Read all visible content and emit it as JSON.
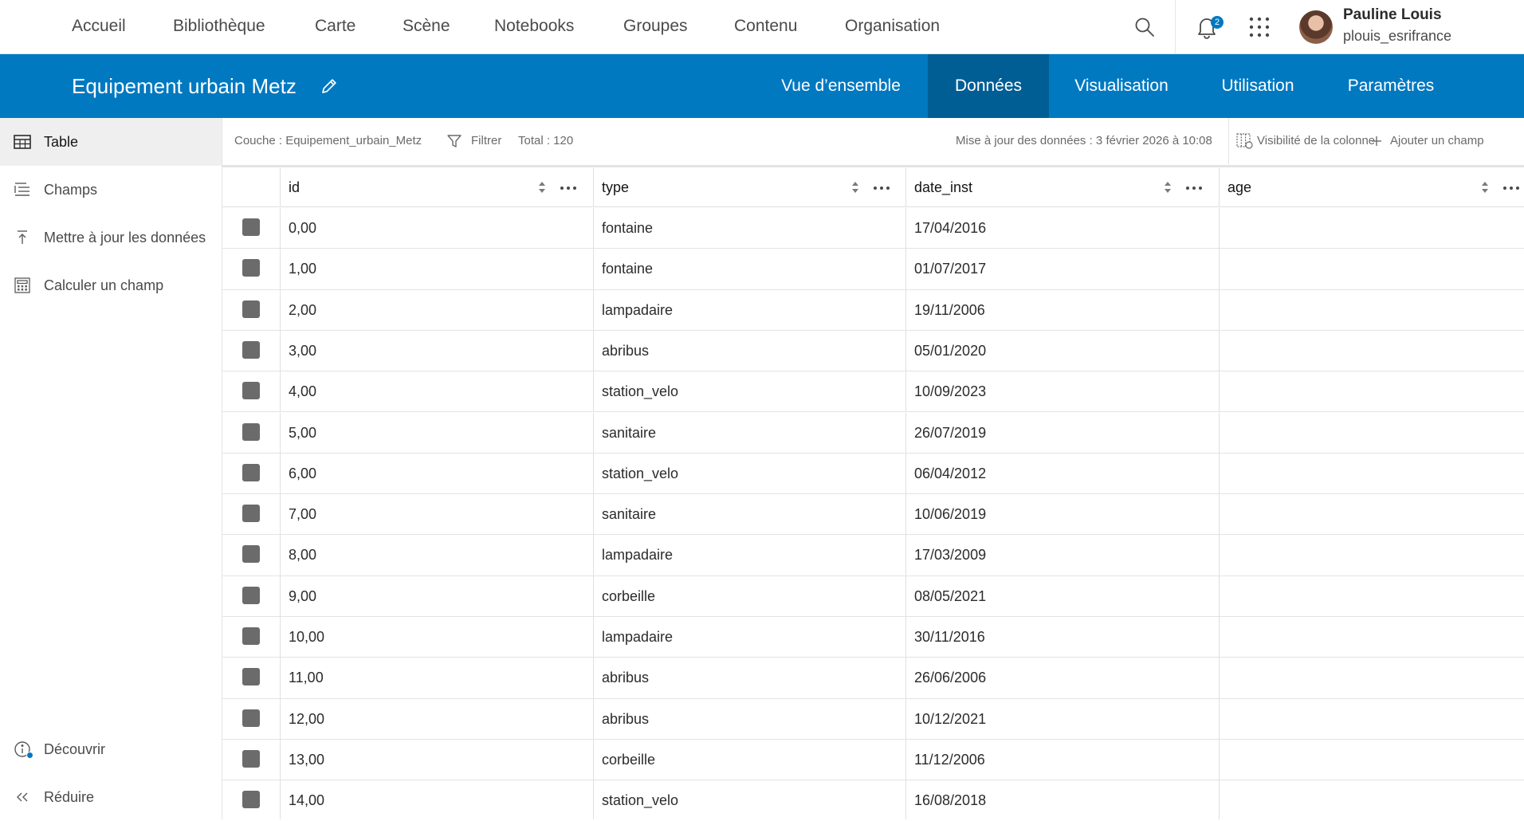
{
  "topnav": {
    "links": [
      "Accueil",
      "Bibliothèque",
      "Carte",
      "Scène",
      "Notebooks",
      "Groupes",
      "Contenu",
      "Organisation"
    ],
    "notification_count": "2",
    "user": {
      "name": "Pauline Louis",
      "login": "plouis_esrifrance"
    },
    "icons": [
      "search-icon",
      "bell-icon",
      "app-launcher-icon"
    ]
  },
  "header": {
    "title": "Equipement urbain Metz",
    "tabs": [
      "Vue d’ensemble",
      "Données",
      "Visualisation",
      "Utilisation",
      "Paramètres"
    ],
    "active_tab": "Données"
  },
  "sidebar": {
    "items": [
      {
        "label": "Table",
        "icon": "table-icon"
      },
      {
        "label": "Champs",
        "icon": "fields-icon"
      },
      {
        "label": "Mettre à jour les données",
        "icon": "upload-icon"
      },
      {
        "label": "Calculer un champ",
        "icon": "calculator-icon"
      }
    ],
    "bottom": [
      {
        "label": "Découvrir",
        "icon": "info-icon"
      },
      {
        "label": "Réduire",
        "icon": "collapse-icon"
      }
    ]
  },
  "toolbar": {
    "layer": "Couche : Equipement_urbain_Metz",
    "filter": "Filtrer",
    "total": "Total : 120",
    "updated": "Mise à jour des données : 3 février 2026 à 10:08",
    "column_visibility": "Visibilité de la colonne",
    "add_field": "Ajouter un champ"
  },
  "table": {
    "columns": [
      "id",
      "type",
      "date_inst",
      "age"
    ],
    "rows": [
      [
        "0,00",
        "fontaine",
        "17/04/2016",
        ""
      ],
      [
        "1,00",
        "fontaine",
        "01/07/2017",
        ""
      ],
      [
        "2,00",
        "lampadaire",
        "19/11/2006",
        ""
      ],
      [
        "3,00",
        "abribus",
        "05/01/2020",
        ""
      ],
      [
        "4,00",
        "station_velo",
        "10/09/2023",
        ""
      ],
      [
        "5,00",
        "sanitaire",
        "26/07/2019",
        ""
      ],
      [
        "6,00",
        "station_velo",
        "06/04/2012",
        ""
      ],
      [
        "7,00",
        "sanitaire",
        "10/06/2019",
        ""
      ],
      [
        "8,00",
        "lampadaire",
        "17/03/2009",
        ""
      ],
      [
        "9,00",
        "corbeille",
        "08/05/2021",
        ""
      ],
      [
        "10,00",
        "lampadaire",
        "30/11/2016",
        ""
      ],
      [
        "11,00",
        "abribus",
        "26/06/2006",
        ""
      ],
      [
        "12,00",
        "abribus",
        "10/12/2021",
        ""
      ],
      [
        "13,00",
        "corbeille",
        "11/12/2006",
        ""
      ],
      [
        "14,00",
        "station_velo",
        "16/08/2018",
        ""
      ]
    ]
  },
  "colors": {
    "brand": "#0079c1",
    "active_tab": "#005e95",
    "checkbox": "#6b6b6b"
  }
}
